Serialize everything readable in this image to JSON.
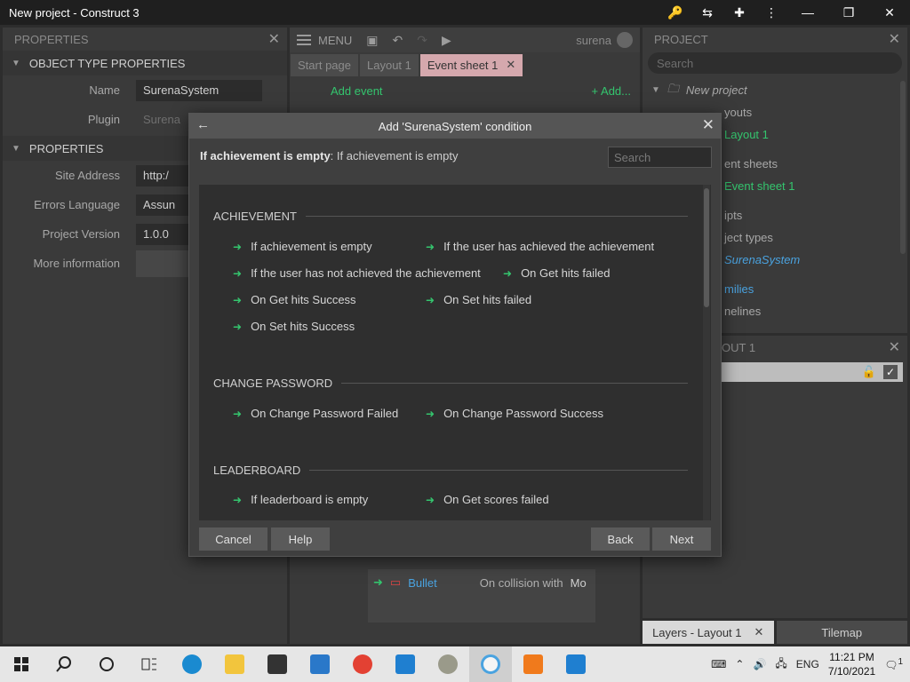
{
  "window": {
    "title": "New project - Construct 3"
  },
  "left_panel": {
    "header": "PROPERTIES",
    "section1": "OBJECT TYPE PROPERTIES",
    "name_label": "Name",
    "name_value": "SurenaSystem",
    "plugin_label": "Plugin",
    "plugin_value": "Surena",
    "section2": "PROPERTIES",
    "site_label": "Site Address",
    "site_value": "http:/",
    "errors_label": "Errors Language",
    "errors_value": "Assun",
    "version_label": "Project Version",
    "version_value": "1.0.0",
    "more_label": "More information"
  },
  "center": {
    "menu_label": "MENU",
    "user": "surena",
    "tabs": [
      {
        "label": "Start page"
      },
      {
        "label": "Layout 1"
      },
      {
        "label": "Event sheet 1"
      }
    ],
    "add_event": "Add event",
    "add_right": "+ Add...",
    "event_row": {
      "object": "Bullet",
      "condition": "On collision with",
      "target": "Mo"
    }
  },
  "right_panel": {
    "header": "PROJECT",
    "search_placeholder": "Search",
    "items": [
      "New project",
      "youts",
      "Layout 1",
      "ent sheets",
      "Event sheet 1",
      "ipts",
      "ject types",
      "SurenaSystem",
      "milies",
      "nelines"
    ],
    "layers_header": "OUT 1"
  },
  "bottom_tabs": {
    "layers": "Layers - Layout 1",
    "tilemap": "Tilemap"
  },
  "dialog": {
    "title": "Add 'SurenaSystem' condition",
    "desc_bold": "If achievement is empty",
    "desc_rest": ": If achievement is empty",
    "search_placeholder": "Search",
    "groups": [
      {
        "name": "ACHIEVEMENT"
      },
      {
        "name": "CHANGE PASSWORD"
      },
      {
        "name": "LEADERBOARD"
      }
    ],
    "conditions": [
      "If achievement is empty",
      "If the user has achieved the achievement",
      "If the user has not achieved the achievement",
      "On Get hits failed",
      "On Get hits Success",
      "On Set hits failed",
      "On Set hits Success",
      "On Change Password Failed",
      "On Change Password Success",
      "If leaderboard is empty",
      "On Get scores failed"
    ],
    "buttons": {
      "cancel": "Cancel",
      "help": "Help",
      "back": "Back",
      "next": "Next"
    }
  },
  "taskbar": {
    "lang": "ENG",
    "time": "11:21 PM",
    "date": "7/10/2021",
    "notif_count": "1"
  }
}
